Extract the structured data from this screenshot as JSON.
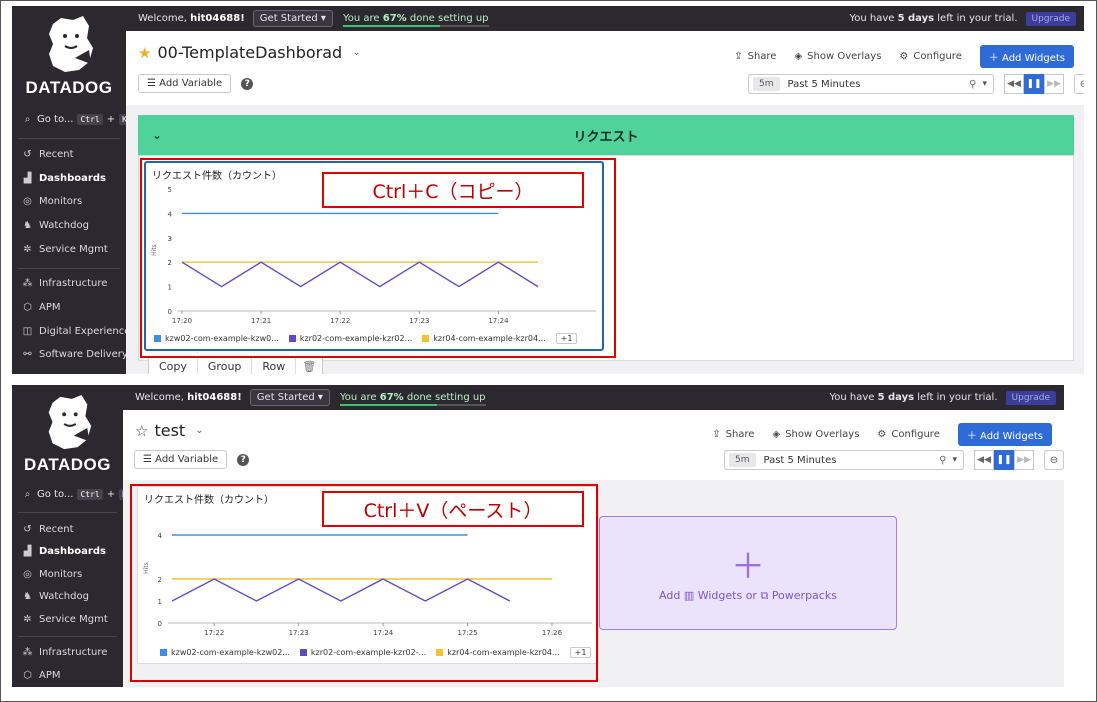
{
  "brand": {
    "name": "DATADOG"
  },
  "top": {
    "welcome_prefix": "Welcome,",
    "user": "hit04688!",
    "get_started": "Get Started",
    "progress_text_prefix": "You are",
    "progress_pct": "67%",
    "progress_text_suffix": "done setting up",
    "progress_value": 0.67,
    "trial_prefix": "You have",
    "trial_days": "5 days",
    "trial_suffix": "left in your trial.",
    "upgrade": "Upgrade"
  },
  "sidebar": {
    "goto": "Go to...",
    "kbd_ctrl": "Ctrl",
    "kbd_plus": "+",
    "kbd_k": "K",
    "items": [
      {
        "label": "Recent",
        "icon": "recent-icon"
      },
      {
        "label": "Dashboards",
        "icon": "dashboards-icon"
      },
      {
        "label": "Monitors",
        "icon": "monitors-icon"
      },
      {
        "label": "Watchdog",
        "icon": "watchdog-icon"
      },
      {
        "label": "Service Mgmt",
        "icon": "service-mgmt-icon"
      },
      {
        "label": "Infrastructure",
        "icon": "infrastructure-icon"
      },
      {
        "label": "APM",
        "icon": "apm-icon"
      },
      {
        "label": "Digital Experience",
        "icon": "digital-experience-icon"
      },
      {
        "label": "Software Delivery",
        "icon": "software-delivery-icon"
      }
    ]
  },
  "header": {
    "share": "Share",
    "show_overlays": "Show Overlays",
    "configure": "Configure",
    "add_widgets": "Add Widgets",
    "add_variable": "Add Variable",
    "help": "?",
    "time_badge": "5m",
    "time_label": "Past 5 Minutes"
  },
  "dash1": {
    "title": "00-TemplateDashborad",
    "group_title": "リクエスト",
    "widget_title": "リクエスト件数（カウント）",
    "context_menu": [
      "Copy",
      "Group",
      "Row"
    ],
    "callout": "Ctrl＋C（コピー）"
  },
  "dash2": {
    "title": "test",
    "widget_title": "リクエスト件数（カウント）",
    "callout": "Ctrl＋V（ペースト）",
    "placeholder_add": "Add",
    "placeholder_widgets": "Widgets or",
    "placeholder_powerpacks": "Powerpacks"
  },
  "colors": {
    "series_blue": "#3d8fe0",
    "series_purple": "#5b4ec4",
    "series_yellow": "#f2c230",
    "series_green": "#2ea36a",
    "accent": "#2f6bd6",
    "group_green": "#4fd39b",
    "callout_red": "#e00000"
  },
  "chart_data": [
    {
      "type": "line",
      "ylabel": "Hits",
      "ylim": [
        0,
        5
      ],
      "yticks": [
        "0",
        "1",
        "2",
        "3",
        "4",
        "5"
      ],
      "x": [
        "17:20",
        "17:20:30",
        "17:21",
        "17:21:30",
        "17:22",
        "17:22:30",
        "17:23",
        "17:23:30",
        "17:24",
        "17:24:15"
      ],
      "xticks": [
        "17:20",
        "17:21",
        "17:22",
        "17:23",
        "17:24"
      ],
      "series": [
        {
          "name": "kzw02-com-example-kzw0...",
          "color": "#3d8fe0",
          "values": [
            4,
            4,
            4,
            4,
            4,
            4,
            4,
            4,
            4,
            null
          ]
        },
        {
          "name": "kzr02-com-example-kzr02...",
          "color": "#5b4ec4",
          "values": [
            2,
            1,
            2,
            1,
            2,
            1,
            2,
            1,
            2,
            1
          ]
        },
        {
          "name": "kzr04-com-example-kzr04...",
          "color": "#f2c230",
          "values": [
            2,
            2,
            2,
            2,
            2,
            2,
            2,
            2,
            2,
            2
          ]
        }
      ],
      "legend_more": "+1"
    },
    {
      "type": "line",
      "ylabel": "Hits",
      "ylim": [
        0,
        5
      ],
      "yticks": [
        "0",
        "1",
        "2",
        "4"
      ],
      "x": [
        "17:21:30",
        "17:22",
        "17:22:30",
        "17:23",
        "17:23:30",
        "17:24",
        "17:24:30",
        "17:25",
        "17:25:30",
        "17:26"
      ],
      "xticks": [
        "17:22",
        "17:23",
        "17:24",
        "17:25",
        "17:26"
      ],
      "series": [
        {
          "name": "kzw02-com-example-kzw02...",
          "color": "#3d8fe0",
          "values": [
            4,
            4,
            4,
            4,
            4,
            4,
            4,
            4,
            null,
            null
          ]
        },
        {
          "name": "kzr02-com-example-kzr02-...",
          "color": "#5b4ec4",
          "values": [
            1,
            2,
            1,
            2,
            1,
            2,
            1,
            2,
            1,
            null
          ]
        },
        {
          "name": "kzr04-com-example-kzr04...",
          "color": "#f2c230",
          "values": [
            2,
            2,
            2,
            2,
            2,
            2,
            2,
            2,
            2,
            2
          ]
        }
      ],
      "legend_more": "+1"
    }
  ]
}
